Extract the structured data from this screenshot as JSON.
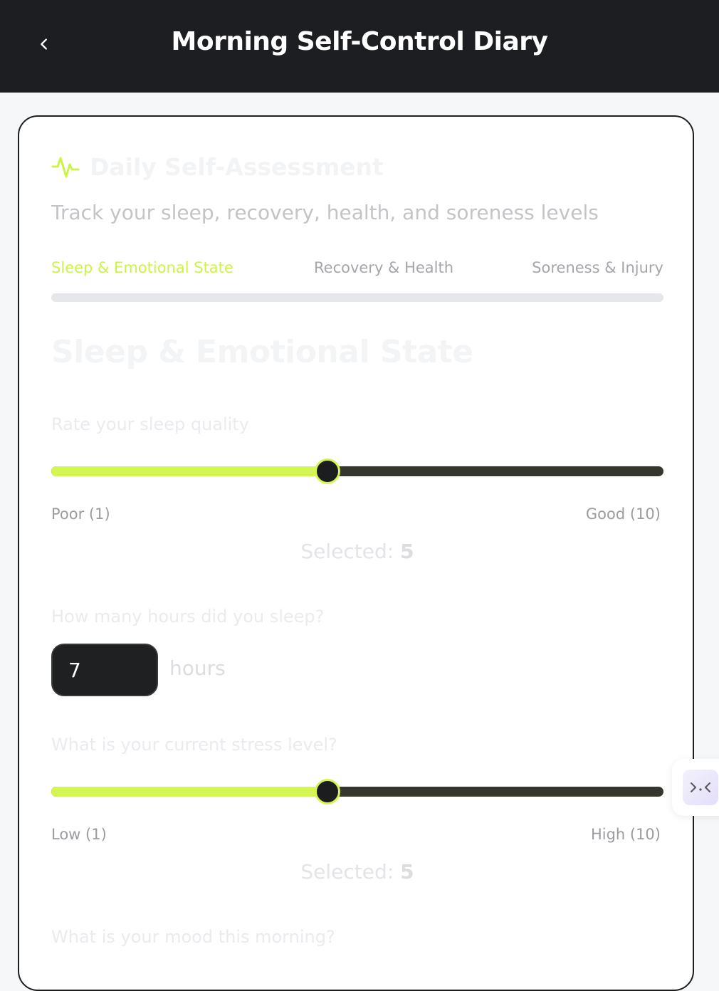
{
  "header": {
    "back_icon": "chevron-left-icon",
    "title": "Morning Self-Control Diary"
  },
  "card": {
    "icon": "activity-pulse-icon",
    "title": "Daily Self-Assessment",
    "subtitle": "Track your sleep, recovery, health, and soreness levels"
  },
  "tabs": [
    {
      "label": "Sleep & Emotional State",
      "active": true
    },
    {
      "label": "Recovery & Health",
      "active": false
    },
    {
      "label": "Soreness & Injury",
      "active": false
    }
  ],
  "section": {
    "title": "Sleep & Emotional State"
  },
  "sleep_quality": {
    "question": "Rate your sleep quality",
    "min": 1,
    "max": 10,
    "value": 5,
    "min_label": "Poor (1)",
    "max_label": "Good (10)",
    "selected_prefix": "Selected:",
    "selected_value": "5"
  },
  "sleep_hours": {
    "question": "How many hours did you sleep?",
    "value": "7",
    "unit": "hours"
  },
  "stress": {
    "question": "What is your current stress level?",
    "min": 1,
    "max": 10,
    "value": 5,
    "min_label": "Low (1)",
    "max_label": "High (10)",
    "selected_prefix": "Selected:",
    "selected_value": "5"
  },
  "mood": {
    "question": "What is your mood this morning?"
  },
  "colors": {
    "accent": "#d3f655",
    "topbar": "#1d1e22",
    "track_dark": "#35372f"
  },
  "floating_widget": {
    "icon": "collapse-arrows-icon"
  }
}
